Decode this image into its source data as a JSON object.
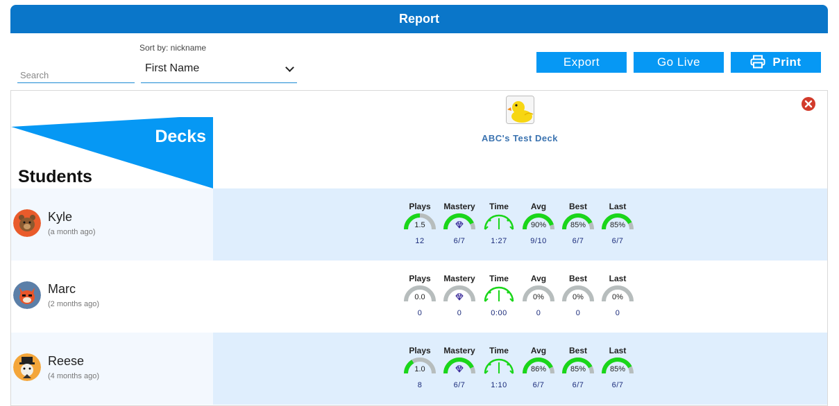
{
  "header": {
    "title": "Report"
  },
  "toolbar": {
    "search_placeholder": "Search",
    "sort_label": "Sort by: nickname",
    "sort_value": "First Name",
    "export_label": "Export",
    "golive_label": "Go Live",
    "print_label": "Print"
  },
  "grid": {
    "decks_label": "Decks",
    "students_label": "Students",
    "deck": {
      "name": "ABC's Test Deck",
      "icon": "rubber-duck-icon"
    }
  },
  "stat_labels": [
    "Plays",
    "Mastery",
    "Time",
    "Avg",
    "Best",
    "Last"
  ],
  "colors": {
    "accent": "#0a76c9",
    "button": "#0698f4",
    "gauge_on": "#1ad61a",
    "gauge_off": "#b7bdbd",
    "row_alt": "#dfeefd"
  },
  "students": [
    {
      "name": "Kyle",
      "ago": "(a month ago)",
      "avatar": "bear-avatar",
      "avatar_bg": "#e95b2b",
      "stats": [
        {
          "gauge": "1.5",
          "fill": 0.5,
          "sub": "12"
        },
        {
          "gauge": "",
          "fill": 0.86,
          "sub": "6/7"
        },
        {
          "gauge": "",
          "fill": 1,
          "sub": "1:27"
        },
        {
          "gauge": "90%",
          "fill": 0.9,
          "sub": "9/10"
        },
        {
          "gauge": "85%",
          "fill": 0.85,
          "sub": "6/7"
        },
        {
          "gauge": "85%",
          "fill": 0.85,
          "sub": "6/7"
        }
      ]
    },
    {
      "name": "Marc",
      "ago": "(2 months ago)",
      "avatar": "fox-avatar",
      "avatar_bg": "#5b7fa8",
      "stats": [
        {
          "gauge": "0.0",
          "fill": 0,
          "sub": "0"
        },
        {
          "gauge": "",
          "fill": 0,
          "sub": "0"
        },
        {
          "gauge": "",
          "fill": 1,
          "sub": "0:00"
        },
        {
          "gauge": "0%",
          "fill": 0,
          "sub": "0"
        },
        {
          "gauge": "0%",
          "fill": 0,
          "sub": "0"
        },
        {
          "gauge": "0%",
          "fill": 0,
          "sub": "0"
        }
      ]
    },
    {
      "name": "Reese",
      "ago": "(4 months ago)",
      "avatar": "gentleman-avatar",
      "avatar_bg": "#f4a63a",
      "stats": [
        {
          "gauge": "1.0",
          "fill": 0.33,
          "sub": "8"
        },
        {
          "gauge": "",
          "fill": 0.86,
          "sub": "6/7"
        },
        {
          "gauge": "",
          "fill": 1,
          "sub": "1:10"
        },
        {
          "gauge": "86%",
          "fill": 0.86,
          "sub": "6/7"
        },
        {
          "gauge": "85%",
          "fill": 0.85,
          "sub": "6/7"
        },
        {
          "gauge": "85%",
          "fill": 0.85,
          "sub": "6/7"
        }
      ]
    }
  ]
}
